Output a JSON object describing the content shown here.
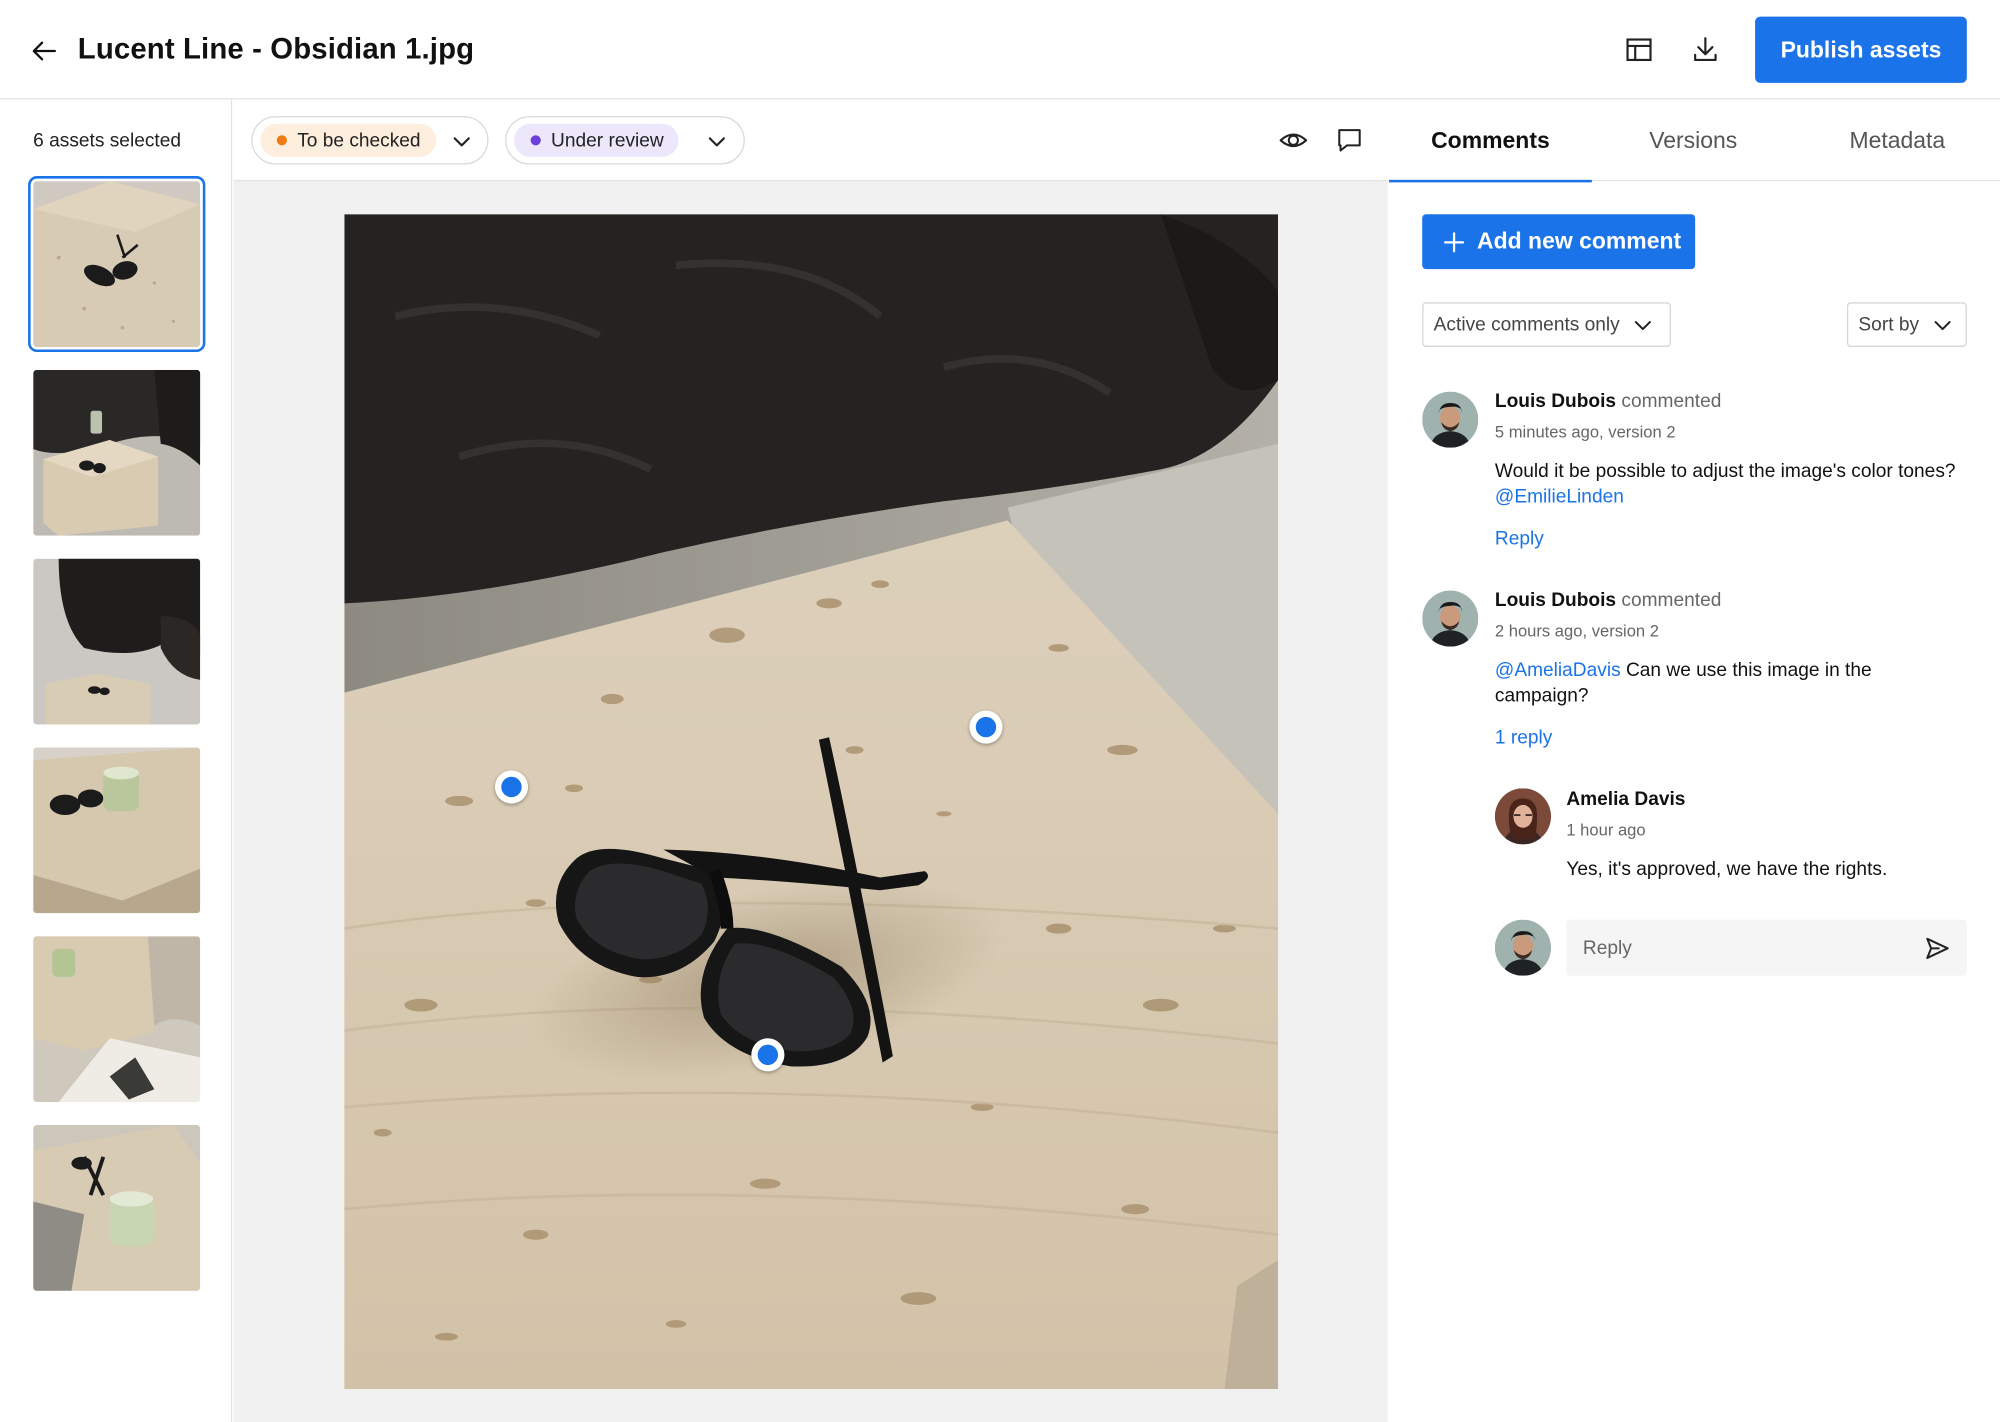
{
  "header": {
    "title": "Lucent Line - Obsidian 1.jpg",
    "back_icon": "arrow-left-icon",
    "layout_icon": "layout-icon",
    "download_icon": "download-icon",
    "publish_label": "Publish assets"
  },
  "sidebar": {
    "selected_count": "6 assets selected",
    "thumbnails": [
      {
        "name": "thumbnail-1",
        "active": true
      },
      {
        "name": "thumbnail-2",
        "active": false
      },
      {
        "name": "thumbnail-3",
        "active": false
      },
      {
        "name": "thumbnail-4",
        "active": false
      },
      {
        "name": "thumbnail-5",
        "active": false
      },
      {
        "name": "thumbnail-6",
        "active": false
      }
    ]
  },
  "toolbar": {
    "status_1": {
      "label": "To be checked",
      "dot_color": "#f07b12",
      "pill_bg": "#fdeede"
    },
    "status_2": {
      "label": "Under review",
      "dot_color": "#6b3fd9",
      "pill_bg": "#ece7fb"
    },
    "eye_icon": "eye-icon",
    "comment_icon": "comment-icon"
  },
  "colors": {
    "accent": "#1a73e8",
    "pin": "#1a73e8"
  },
  "panel": {
    "tabs": [
      {
        "label": "Comments",
        "active": true
      },
      {
        "label": "Versions",
        "active": false
      },
      {
        "label": "Metadata",
        "active": false
      }
    ],
    "add_comment_label": "Add new comment",
    "filter_label": "Active comments only",
    "sort_label": "Sort by",
    "comments": [
      {
        "author": "Louis Dubois",
        "action": "commented",
        "meta": "5 minutes ago, version 2",
        "text_before": "Would it be possible to adjust the image's color tones?",
        "mention": "@EmilieLinden",
        "text_after": "",
        "link": "Reply"
      },
      {
        "author": "Louis Dubois",
        "action": "commented",
        "meta": "2 hours ago, version 2",
        "mention": "@AmeliaDavis",
        "text_after": "Can we use this image in the campaign?",
        "link": "1 reply"
      }
    ],
    "reply": {
      "author": "Amelia Davis",
      "meta": "1 hour ago",
      "text": "Yes, it's approved, we have the rights."
    },
    "reply_placeholder": "Reply",
    "send_icon": "send-icon"
  }
}
